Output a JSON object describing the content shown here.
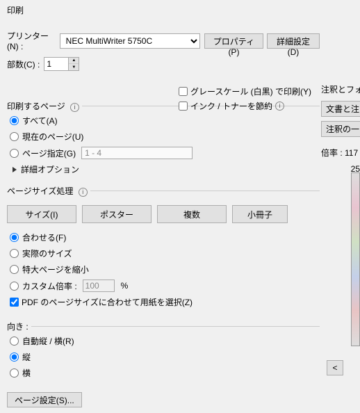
{
  "title": "印刷",
  "printer": {
    "label": "プリンター(N) :",
    "selected": "NEC MultiWriter 5750C",
    "properties_btn": "プロパティ(P)",
    "advanced_btn": "詳細設定(D)"
  },
  "copies": {
    "label": "部数(C) :",
    "value": "1"
  },
  "options": {
    "grayscale": "グレースケール (白黒) で印刷(Y)",
    "ink_save": "インク / トナーを節約"
  },
  "pages": {
    "group": "印刷するページ",
    "all": "すべて(A)",
    "current": "現在のページ(U)",
    "range": "ページ指定(G)",
    "range_value": "1 - 4",
    "advanced": "詳細オプション"
  },
  "sizing": {
    "group": "ページサイズ処理",
    "size_btn": "サイズ(I)",
    "poster_btn": "ポスター",
    "multi_btn": "複数",
    "booklet_btn": "小冊子",
    "fit": "合わせる(F)",
    "actual": "実際のサイズ",
    "shrink": "特大ページを縮小",
    "custom": "カスタム倍率 :",
    "custom_value": "100",
    "custom_unit": "%",
    "choose_paper": "PDF のページサイズに合わせて用紙を選択(Z)"
  },
  "orientation": {
    "group": "向き :",
    "auto": "自動縦 / 横(R)",
    "portrait": "縦",
    "landscape": "横"
  },
  "right": {
    "annotations_label": "注釈とフォ",
    "docs_btn": "文書と注",
    "annot_summary_btn": "注釈の一",
    "zoom_label": "倍率 : 117",
    "dim": "25"
  },
  "nav_prev": "<",
  "page_setup": "ページ設定(S)..."
}
